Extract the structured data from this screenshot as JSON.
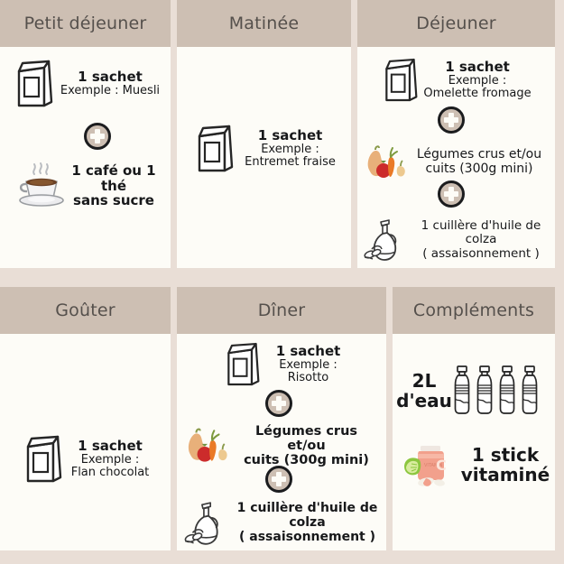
{
  "meta": {
    "background_color": "#e9ded6",
    "card_color": "#fdfcf7",
    "header_color": "#cdbfb3",
    "header_text_color": "#55504c",
    "body_text_color": "#17181a"
  },
  "columns": [
    {
      "id": "petit-dejeuner",
      "title": "Petit déjeuner",
      "items": [
        {
          "icon": "sachet-bag-icon",
          "lines": [
            {
              "text": "1 sachet",
              "style": "strong"
            },
            {
              "text": "Exemple : Muesli",
              "style": "normal"
            }
          ]
        },
        {
          "icon": "coffee-cup-icon",
          "lines": [
            {
              "text": "1 café ou 1",
              "style": "strong"
            },
            {
              "text": "thé",
              "style": "strong"
            },
            {
              "text": "sans sucre",
              "style": "strong"
            }
          ]
        }
      ],
      "separators": [
        "plus-badge-icon"
      ]
    },
    {
      "id": "matinee",
      "title": "Matinée",
      "items": [
        {
          "icon": "sachet-bag-icon",
          "lines": [
            {
              "text": "1 sachet",
              "style": "strong"
            },
            {
              "text": "Exemple :",
              "style": "normal"
            },
            {
              "text": "Entremet fraise",
              "style": "normal"
            }
          ]
        }
      ],
      "separators": []
    },
    {
      "id": "dejeuner",
      "title": "Déjeuner",
      "items": [
        {
          "icon": "sachet-bag-icon",
          "lines": [
            {
              "text": "1 sachet",
              "style": "strong"
            },
            {
              "text": "Exemple :",
              "style": "normal"
            },
            {
              "text": "Omelette fromage",
              "style": "normal"
            }
          ]
        },
        {
          "icon": "vegetables-icon",
          "lines": [
            {
              "text": "Légumes crus et/ou",
              "style": "normal"
            },
            {
              "text": "cuits (300g mini)",
              "style": "normal"
            }
          ]
        },
        {
          "icon": "oil-bottle-icon",
          "lines": [
            {
              "text": "1 cuillère d'huile de",
              "style": "normal"
            },
            {
              "text": "colza",
              "style": "normal"
            },
            {
              "text": "( assaisonnement )",
              "style": "normal"
            }
          ]
        }
      ],
      "separators": [
        "plus-badge-icon",
        "plus-badge-icon"
      ]
    },
    {
      "id": "gouter",
      "title": "Goûter",
      "items": [
        {
          "icon": "sachet-bag-icon",
          "lines": [
            {
              "text": "1 sachet",
              "style": "strong"
            },
            {
              "text": "Exemple :",
              "style": "normal"
            },
            {
              "text": "Flan chocolat",
              "style": "normal"
            }
          ]
        }
      ],
      "separators": []
    },
    {
      "id": "diner",
      "title": "Dîner",
      "items": [
        {
          "icon": "sachet-bag-icon",
          "lines": [
            {
              "text": "1 sachet",
              "style": "strong"
            },
            {
              "text": "Exemple :",
              "style": "normal"
            },
            {
              "text": "Risotto",
              "style": "normal"
            }
          ]
        },
        {
          "icon": "vegetables-icon",
          "lines": [
            {
              "text": "Légumes crus et/ou",
              "style": "strong"
            },
            {
              "text": "cuits (300g mini)",
              "style": "strong"
            }
          ]
        },
        {
          "icon": "oil-bottle-icon",
          "lines": [
            {
              "text": "1 cuillère d'huile de",
              "style": "strong"
            },
            {
              "text": "colza",
              "style": "strong"
            },
            {
              "text": "( assaisonnement )",
              "style": "strong"
            }
          ]
        }
      ],
      "separators": [
        "plus-badge-icon",
        "plus-badge-icon"
      ]
    },
    {
      "id": "complements",
      "title": "Compléments",
      "items": [
        {
          "icon": "water-bottles-icon",
          "lines": [
            {
              "text": "2L",
              "style": "strong"
            },
            {
              "text": "d'eau",
              "style": "strong"
            }
          ]
        },
        {
          "icon": "vitamin-jar-icon",
          "lines": [
            {
              "text": "1 stick",
              "style": "strong"
            },
            {
              "text": "vitaminé",
              "style": "strong"
            }
          ]
        }
      ],
      "separators": []
    }
  ]
}
